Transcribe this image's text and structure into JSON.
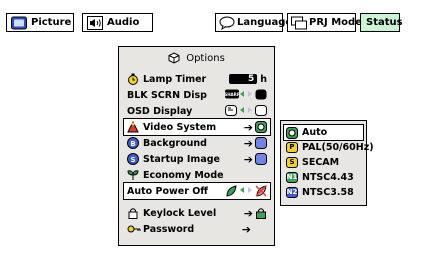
{
  "topbar": {
    "picture": "Picture",
    "audio": "Audio",
    "language": "Language",
    "prj_mode": "PRJ Mode",
    "status": "Status"
  },
  "options": {
    "title": "Options",
    "items": [
      {
        "label": "Lamp Timer",
        "value": "5",
        "unit": "h"
      },
      {
        "label": "BLK SCRN Disp"
      },
      {
        "label": "OSD Display"
      },
      {
        "label": "Video System"
      },
      {
        "label": "Background"
      },
      {
        "label": "Startup Image"
      },
      {
        "label": "Economy Mode"
      },
      {
        "label": "Auto Power Off"
      },
      {
        "label": "Keylock Level"
      },
      {
        "label": "Password"
      }
    ]
  },
  "video_system": {
    "options": [
      {
        "badge": "auto",
        "label": "Auto"
      },
      {
        "badge": "P",
        "label": "PAL(50/60Hz)"
      },
      {
        "badge": "S",
        "label": "SECAM"
      },
      {
        "badge": "N1",
        "label": "NTSC4.43"
      },
      {
        "badge": "N2",
        "label": "NTSC3.58"
      }
    ]
  },
  "colors": {
    "menu_bg": "#e8e6e3",
    "status_bg": "#c9f5d6",
    "accent_green": "#3aa35a",
    "accent_yellow": "#f2d21b",
    "accent_blue": "#3b5bdb"
  }
}
